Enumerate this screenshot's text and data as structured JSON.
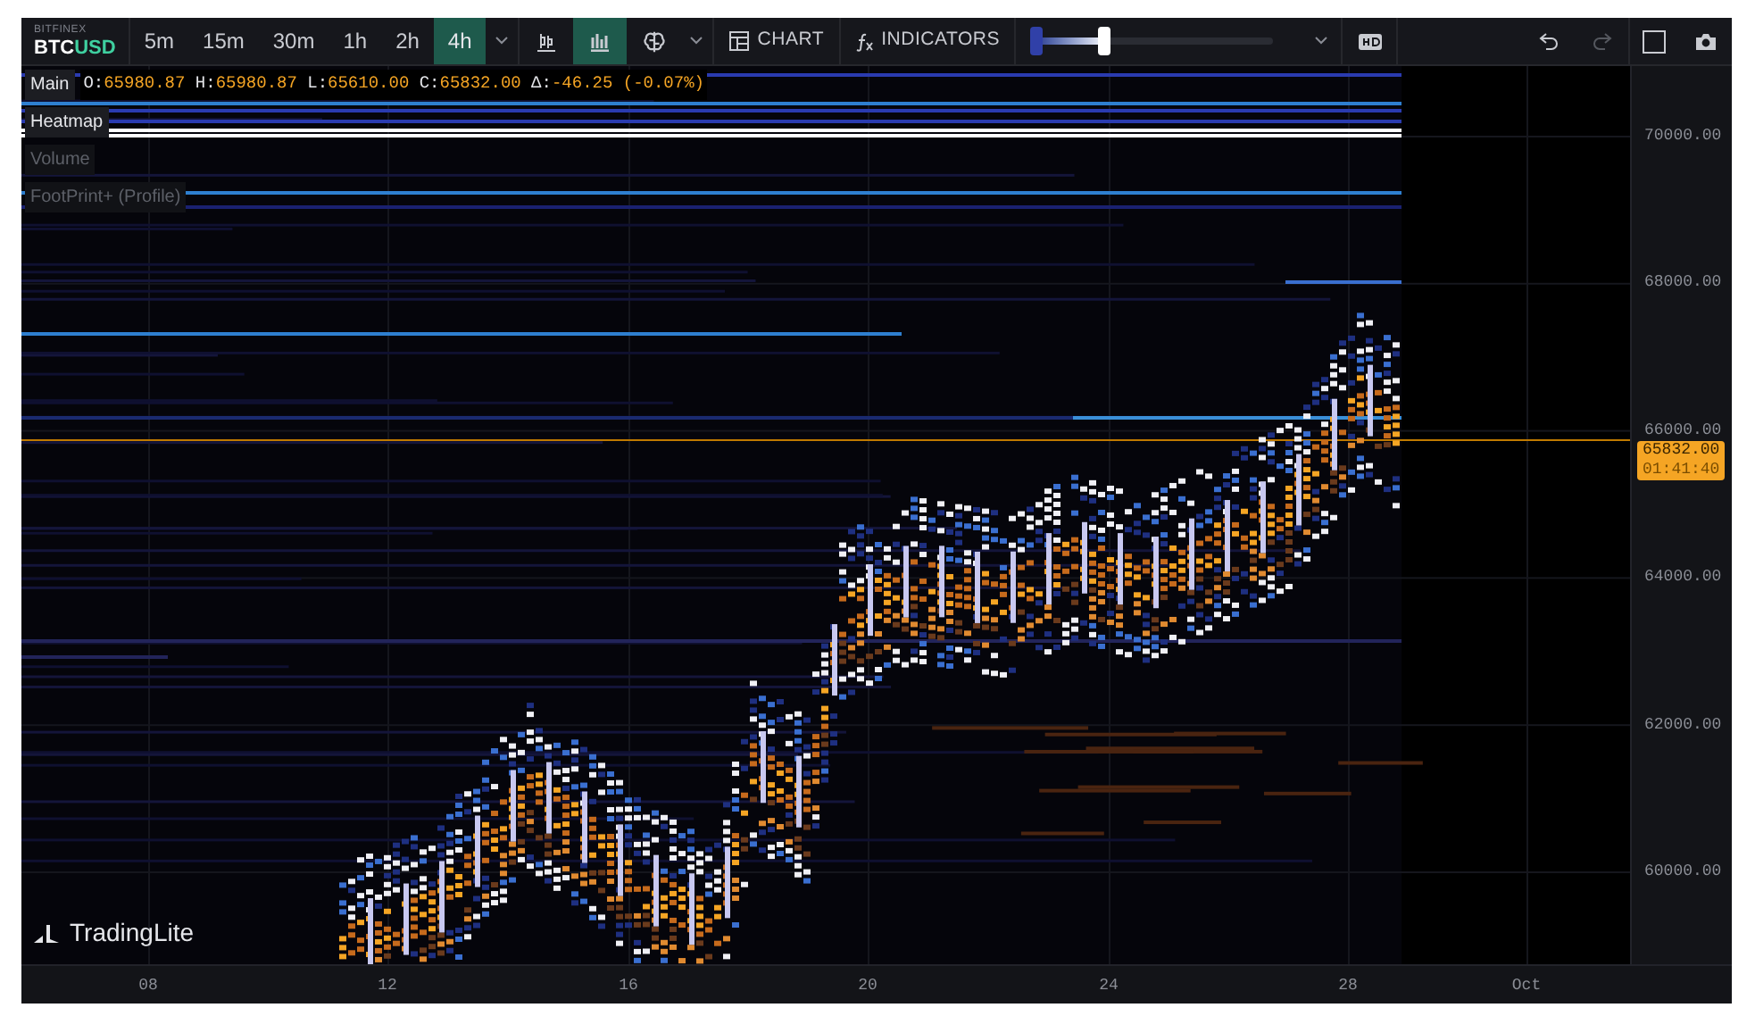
{
  "symbol": {
    "exchange": "BITFINEX",
    "base": "BTC",
    "quote": "USD"
  },
  "timeframes": [
    {
      "label": "5m",
      "selected": false
    },
    {
      "label": "15m",
      "selected": false
    },
    {
      "label": "30m",
      "selected": false
    },
    {
      "label": "1h",
      "selected": false
    },
    {
      "label": "2h",
      "selected": false
    },
    {
      "label": "4h",
      "selected": true
    }
  ],
  "chart_types": [
    {
      "selected": false
    },
    {
      "selected": true
    }
  ],
  "toolbar": {
    "chart_button": "CHART",
    "indicators_button": "INDICATORS",
    "slider": {
      "level": 0.3
    }
  },
  "legend": {
    "pane": "Main",
    "values": [
      {
        "label": "O:",
        "value": "65980.87"
      },
      {
        "label": "H:",
        "value": "65980.87"
      },
      {
        "label": "L:",
        "value": "65610.00"
      },
      {
        "label": "C:",
        "value": "65832.00"
      },
      {
        "label": "Δ:",
        "value": "-46.25 (-0.07%)"
      }
    ]
  },
  "overlays": [
    {
      "label": "Heatmap",
      "visible": true
    },
    {
      "label": "Volume",
      "visible": false
    },
    {
      "label": "FootPrint+ (Profile)",
      "visible": false
    }
  ],
  "price_axis": [
    "70000.00",
    "68000.00",
    "66000.00",
    "64000.00",
    "62000.00",
    "60000.00"
  ],
  "price_tag": {
    "price": "65832.00",
    "countdown": "01:41:40"
  },
  "time_axis": [
    "08",
    "12",
    "16",
    "20",
    "24",
    "28",
    "Oct"
  ],
  "logo": "TradingLite"
}
